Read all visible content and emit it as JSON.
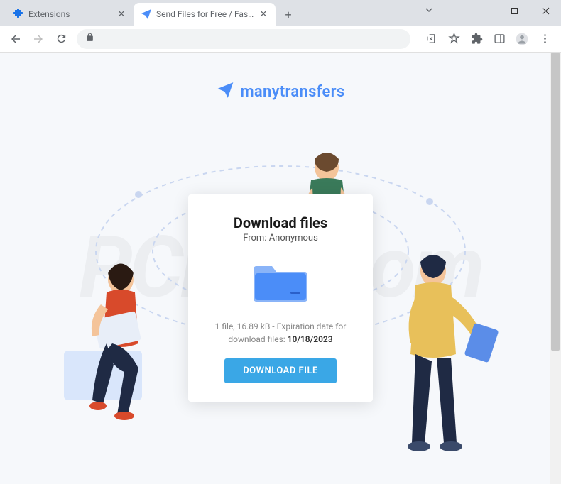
{
  "tabs": [
    {
      "title": "Extensions",
      "active": false
    },
    {
      "title": "Send Files for Free / Fast & Secu",
      "active": true
    }
  ],
  "brand": {
    "name": "manytransfers"
  },
  "card": {
    "title": "Download files",
    "from_label": "From: ",
    "from_value": "Anonymous",
    "info_prefix": "1 file, 16.89 kB - Expiration date for download files: ",
    "info_date": "10/18/2023",
    "button": "DOWNLOAD FILE"
  }
}
